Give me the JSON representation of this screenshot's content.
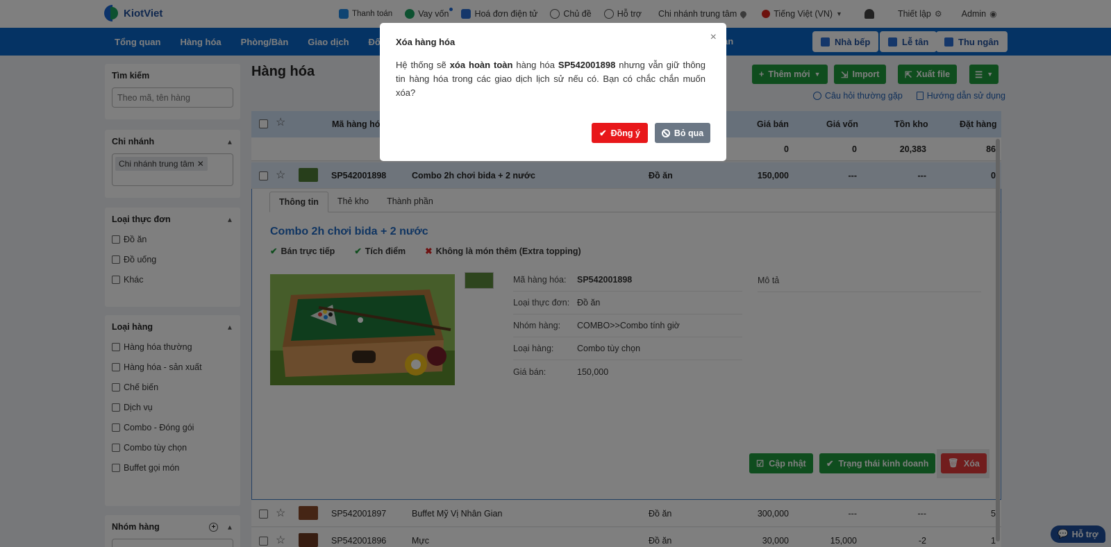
{
  "app": {
    "name": "KiotViet"
  },
  "topbar": {
    "links": [
      {
        "label": "Thanh toán",
        "icon": "payment-icon"
      },
      {
        "label": "Vay vốn",
        "icon": "loan-icon"
      },
      {
        "label": "Hoá đơn điện tử",
        "icon": "e-invoice-icon"
      },
      {
        "label": "Chủ đề",
        "icon": "palette-icon"
      },
      {
        "label": "Hỗ trợ",
        "icon": "chat-icon"
      },
      {
        "label": "Chi nhánh trung tâm",
        "icon": "location-icon"
      },
      {
        "label": "Tiếng Việt (VN)",
        "icon": "vn-flag-icon"
      }
    ],
    "settings_label": "Thiết lập",
    "user_label": "Admin"
  },
  "nav": {
    "items": [
      "Tổng quan",
      "Hàng hóa",
      "Phòng/Bàn",
      "Giao dịch",
      "Đối tác",
      "",
      "",
      "",
      "",
      "",
      "",
      "",
      "an"
    ],
    "buttons": [
      "Nhà bếp",
      "Lễ tân",
      "Thu ngân"
    ]
  },
  "sidebar": {
    "search": {
      "title": "Tìm kiếm",
      "placeholder": "Theo mã, tên hàng"
    },
    "branch": {
      "title": "Chi nhánh",
      "chip": "Chi nhánh trung tâm"
    },
    "menu_type": {
      "title": "Loại thực đơn",
      "options": [
        "Đồ ăn",
        "Đồ uống",
        "Khác"
      ]
    },
    "item_type": {
      "title": "Loại hàng",
      "options": [
        "Hàng hóa thường",
        "Hàng hóa - sản xuất",
        "Chế biến",
        "Dịch vụ",
        "Combo - Đóng gói",
        "Combo tùy chọn",
        "Buffet gọi món"
      ]
    },
    "group": {
      "title": "Nhóm hàng"
    }
  },
  "main": {
    "title": "Hàng hóa",
    "buttons": {
      "add": "Thêm mới",
      "import": "Import",
      "export": "Xuất file"
    },
    "help_links": [
      "Câu hỏi thường gặp",
      "Hướng dẫn sử dụng"
    ],
    "columns": {
      "code": "Mã hàng hóa",
      "price": "Giá bán",
      "cost": "Giá vốn",
      "stock": "Tồn kho",
      "ordered": "Đặt hàng"
    },
    "summary": {
      "price": "0",
      "cost": "0",
      "stock": "20,383",
      "ordered": "86"
    },
    "rows": [
      {
        "code": "SP542001898",
        "name": "Combo 2h chơi bida + 2 nước",
        "type": "Đồ ăn",
        "price": "150,000",
        "cost": "---",
        "stock": "---",
        "ordered": "0"
      },
      {
        "code": "SP542001897",
        "name": "Buffet Mỹ Vị Nhân Gian",
        "type": "Đồ ăn",
        "price": "300,000",
        "cost": "---",
        "stock": "---",
        "ordered": "5"
      },
      {
        "code": "SP542001896",
        "name": "Mực",
        "type": "Đồ ăn",
        "price": "30,000",
        "cost": "15,000",
        "stock": "-2",
        "ordered": "1"
      }
    ]
  },
  "detail": {
    "tabs": [
      "Thông tin",
      "Thẻ kho",
      "Thành phần"
    ],
    "name": "Combo 2h chơi bida + 2 nước",
    "flags": [
      {
        "label": "Bán trực tiếp",
        "on": true
      },
      {
        "label": "Tích điểm",
        "on": true
      },
      {
        "label": "Không là món thêm (Extra topping)",
        "on": false
      }
    ],
    "fields": [
      {
        "k": "Mã hàng hóa:",
        "v": "SP542001898"
      },
      {
        "k": "Loại thực đơn:",
        "v": "Đồ ăn"
      },
      {
        "k": "Nhóm hàng:",
        "v": "COMBO>>Combo tính giờ"
      },
      {
        "k": "Loại hàng:",
        "v": "Combo tùy chọn"
      },
      {
        "k": "Giá bán:",
        "v": "150,000"
      }
    ],
    "desc_label": "Mô tả",
    "actions": {
      "update": "Cập nhật",
      "status": "Trạng thái kinh doanh",
      "delete": "Xóa"
    }
  },
  "support_float": "Hỗ trợ",
  "modal": {
    "title": "Xóa hàng hóa",
    "text_1": "Hệ thống sẽ ",
    "text_bold_1": "xóa hoàn toàn",
    "text_2": " hàng hóa ",
    "text_bold_2": "SP542001898",
    "text_3": " nhưng vẫn giữ thông tin hàng hóa trong các giao dịch lịch sử nếu có. Bạn có chắc chắn muốn xóa?",
    "confirm": "Đồng ý",
    "cancel": "Bỏ qua"
  },
  "colors": {
    "nav": "#0b66c8",
    "green": "#1f9a3c",
    "red": "#e8171a",
    "link": "#1e68c2"
  }
}
